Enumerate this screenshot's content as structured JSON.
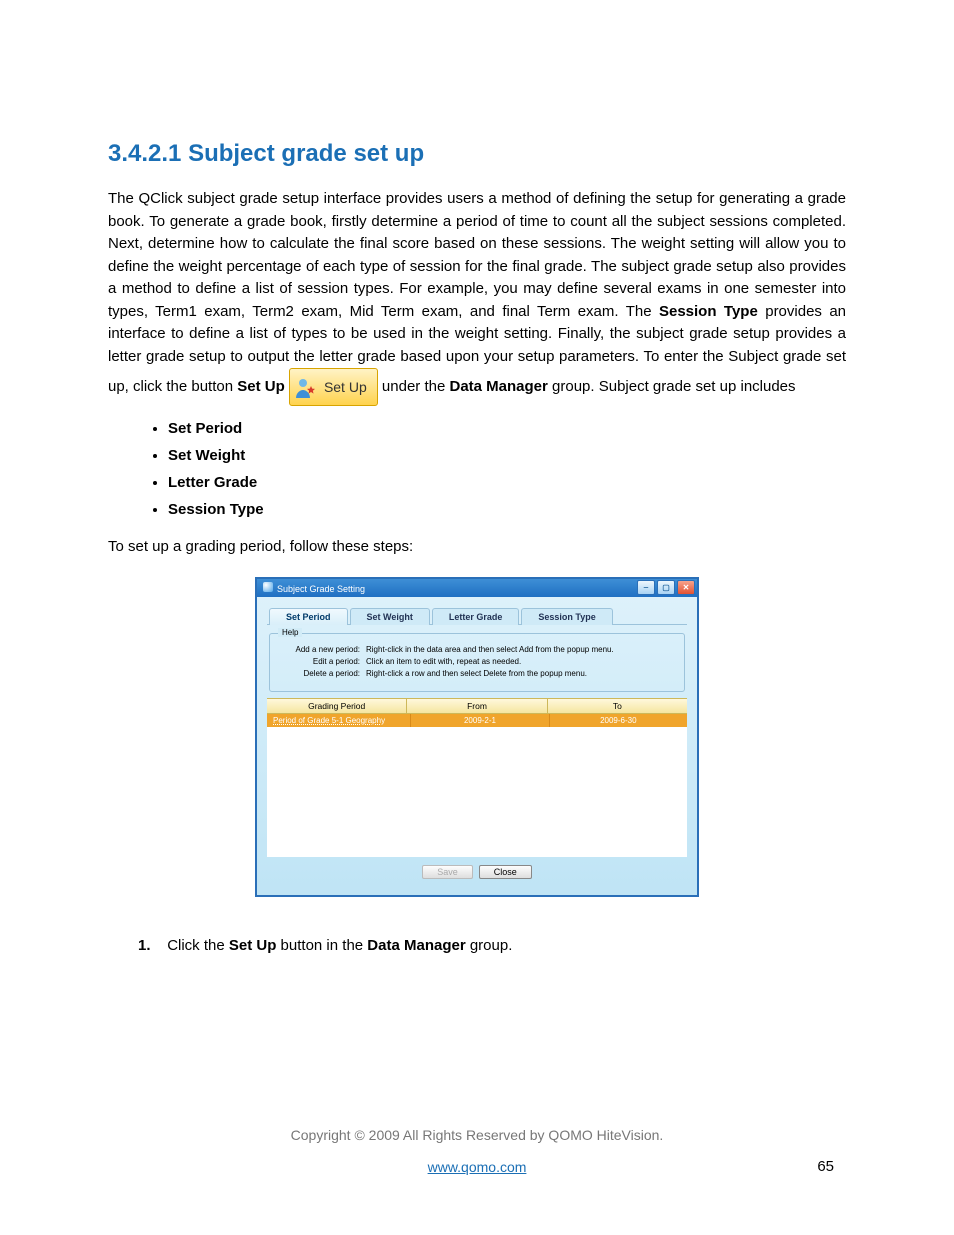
{
  "heading": "3.4.2.1 Subject grade set up",
  "para1_a": "The QClick subject grade setup interface provides users a method of defining the setup for generating a grade book. To generate a grade book, firstly determine a period of time to count all the subject sessions completed. Next, determine how to calculate the final score based on these sessions. The weight setting will allow you to define the weight percentage of each type of session for the final grade. The subject grade setup also provides a method to define a list of session types. For example, you may define several exams in one semester into types, Term1 exam, Term2 exam, Mid Term exam, and final Term exam. The ",
  "para1_b1": "Session Type",
  "para1_c": " provides an interface to define a list of types to be used in the weight setting. Finally, the subject grade setup provides a letter grade setup to output the letter grade based upon your setup parameters. To enter the Subject grade set up, click the button ",
  "para1_b2": "Set Up",
  "inline_btn_label": "Set Up",
  "para1_d": "under the ",
  "para1_b3": "Data Manager",
  "para1_e": " group. Subject grade set up includes",
  "bullets": [
    "Set Period",
    "Set Weight",
    "Letter Grade",
    "Session Type"
  ],
  "para2": "To set up a grading period, follow these steps:",
  "screenshot": {
    "title": "Subject Grade Setting",
    "tabs": [
      "Set Period",
      "Set Weight",
      "Letter Grade",
      "Session Type"
    ],
    "help_legend": "Help",
    "help_rows": [
      {
        "k": "Add a new period:",
        "v": "Right-click in the data area and then select Add from the popup menu."
      },
      {
        "k": "Edit a period:",
        "v": "Click an item to edit with, repeat as needed."
      },
      {
        "k": "Delete a period:",
        "v": "Right-click a row and then select Delete from the popup menu."
      }
    ],
    "grid_head": [
      "Grading Period",
      "From",
      "To"
    ],
    "grid_row": [
      "Period of Grade 5-1 Geography",
      "2009-2-1",
      "2009-6-30"
    ],
    "btn_save": "Save",
    "btn_close": "Close"
  },
  "step1_a": "Click the ",
  "step1_b1": "Set Up",
  "step1_b": " button in the ",
  "step1_b2": "Data Manager",
  "step1_c": " group.",
  "copyright": "Copyright © 2009 All Rights Reserved by QOMO HiteVision.",
  "site": "www.qomo.com",
  "page_num": "65"
}
